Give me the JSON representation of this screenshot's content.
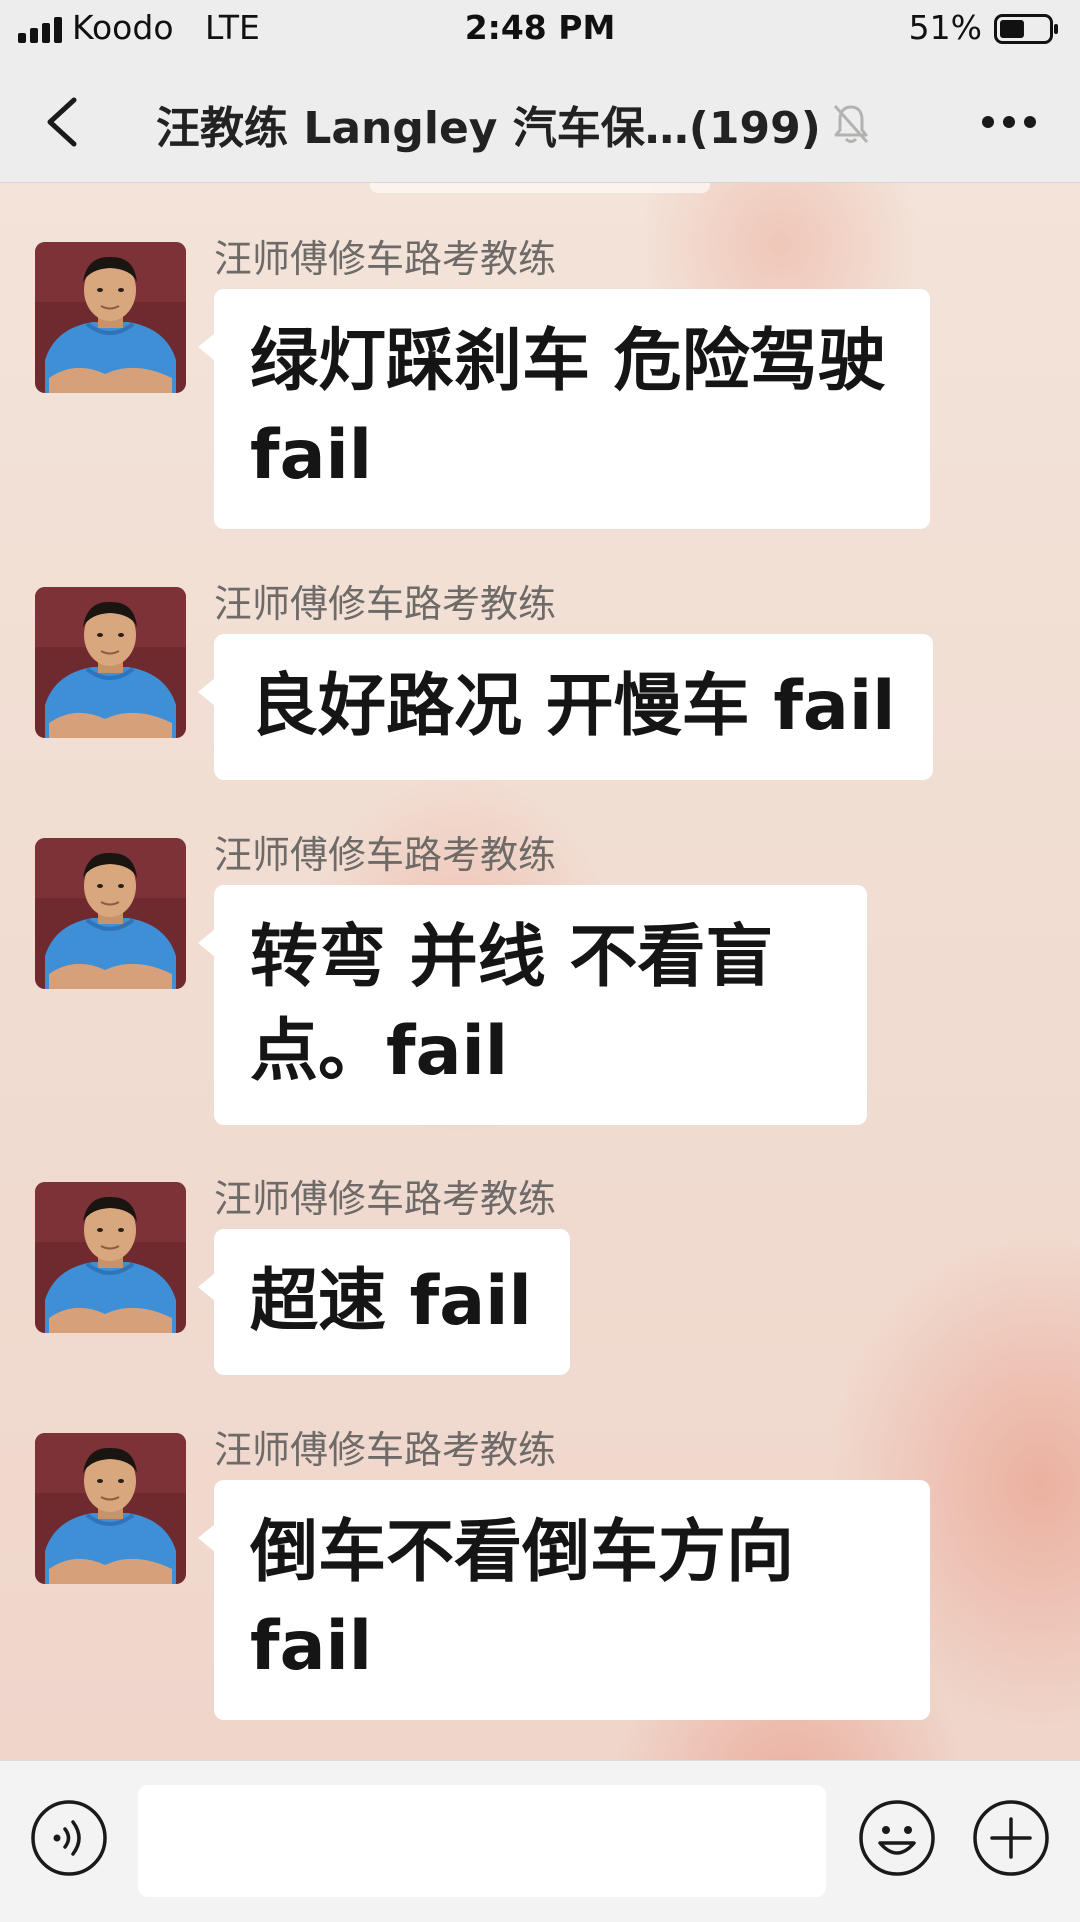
{
  "status_bar": {
    "carrier": "Koodo",
    "network": "LTE",
    "time": "2:48 PM",
    "battery_percent": "51%",
    "battery_level": 0.51
  },
  "nav": {
    "title": "汪教练 Langley 汽车保…(199)",
    "icons": {
      "back": "chevron-left-icon",
      "muted": "muted-bell-icon",
      "more": "more-dots-icon"
    }
  },
  "messages": [
    {
      "sender": "汪师傅修车路考教练",
      "text": "绿灯踩刹车 危险驾驶 fail"
    },
    {
      "sender": "汪师傅修车路考教练",
      "text": "良好路况 开慢车 fail"
    },
    {
      "sender": "汪师傅修车路考教练",
      "text": "转弯 并线 不看盲点。fail"
    },
    {
      "sender": "汪师傅修车路考教练",
      "text": "超速 fail"
    },
    {
      "sender": "汪师傅修车路考教练",
      "text": "倒车不看倒车方向 fail"
    }
  ],
  "input_bar": {
    "icons": {
      "voice": "voice-wave-icon",
      "emoji": "smiley-face-icon",
      "plus": "plus-circle-icon"
    }
  },
  "colors": {
    "bar_bg": "#ededed",
    "bubble_bg": "#ffffff",
    "sender_text": "#6d6a68",
    "chat_bg": "#f1ddd2"
  }
}
